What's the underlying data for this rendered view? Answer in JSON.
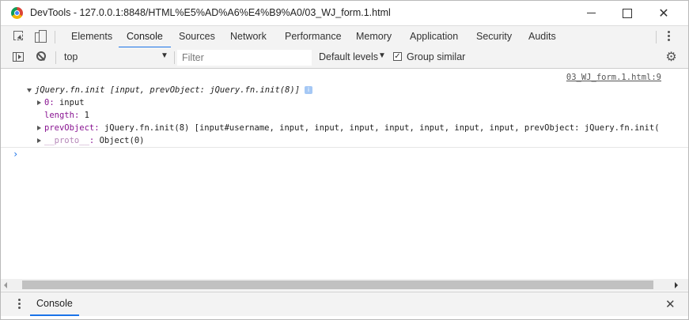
{
  "window": {
    "title": "DevTools - 127.0.0.1:8848/HTML%E5%AD%A6%E4%B9%A0/03_WJ_form.1.html",
    "minimize_icon": "minimize-icon",
    "maximize_icon": "maximize-icon",
    "close_label": "✕"
  },
  "tabs": [
    {
      "label": "Elements"
    },
    {
      "label": "Console",
      "active": true
    },
    {
      "label": "Sources"
    },
    {
      "label": "Network"
    },
    {
      "label": "Performance"
    },
    {
      "label": "Memory"
    },
    {
      "label": "Application"
    },
    {
      "label": "Security"
    },
    {
      "label": "Audits"
    }
  ],
  "toolbar": {
    "context": "top",
    "context_arrow": "▼",
    "filter_placeholder": "Filter",
    "levels_label": "Default levels",
    "levels_arrow": "▼",
    "group_similar_label": "Group similar",
    "group_similar_checked": true,
    "check_mark": "✓",
    "settings_glyph": "⚙"
  },
  "console": {
    "source_link": "03_WJ_form.1.html:9",
    "header": {
      "name": "jQuery.fn.init",
      "content": "[input, prevObject: jQuery.fn.init(8)]",
      "info_badge": "i"
    },
    "entries": [
      {
        "key": "0",
        "value": "input",
        "expandable": true
      },
      {
        "key": "length",
        "value": "1",
        "expandable": false
      },
      {
        "key": "prevObject",
        "value": "jQuery.fn.init(8) [input#username, input, input, input, input, input, input, input, prevObject: jQuery.fn.init(",
        "expandable": true
      },
      {
        "key": "__proto__",
        "value": "Object(0)",
        "expandable": true
      }
    ],
    "prompt": "›"
  },
  "drawer": {
    "tab_label": "Console",
    "close_label": "✕"
  }
}
